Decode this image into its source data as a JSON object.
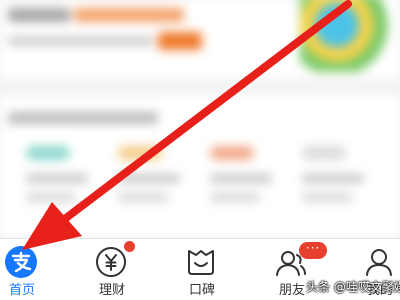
{
  "tabbar": {
    "items": [
      {
        "label": "首页",
        "icon": "alipay-logo-icon",
        "active": true
      },
      {
        "label": "理财",
        "icon": "yuan-coin-icon",
        "active": false
      },
      {
        "label": "口碑",
        "icon": "koubei-smile-icon",
        "active": false
      },
      {
        "label": "朋友",
        "icon": "friends-icon",
        "active": false
      },
      {
        "label": "我的",
        "icon": "person-icon",
        "active": false
      }
    ],
    "badge_friends": "···"
  },
  "watermark": "头条 @哇哎文聚娱",
  "colors": {
    "accent": "#1677ff",
    "arrow": "#e8201a",
    "badge": "#e8402f"
  }
}
